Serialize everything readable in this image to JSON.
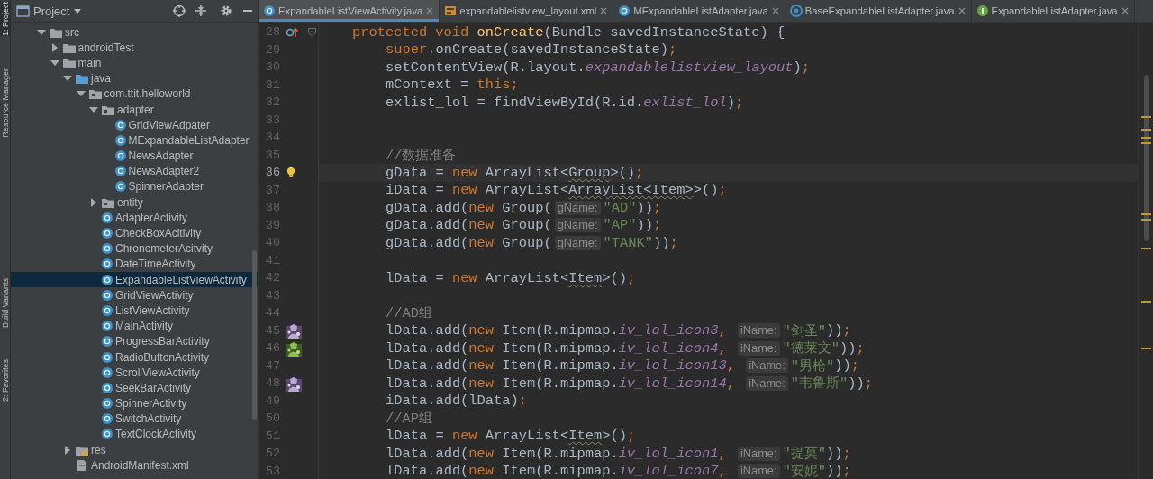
{
  "side_tabs": [
    {
      "label": "1: Project",
      "selected": true
    },
    {
      "label": "Resource Manager",
      "selected": false
    },
    {
      "label": "Build Variants",
      "selected": false
    },
    {
      "label": "2: Favorites",
      "selected": false
    }
  ],
  "project_panel": {
    "title": "Project",
    "tree": [
      {
        "label": "src",
        "kind": "folder",
        "expanded": true,
        "selected": false,
        "children": [
          {
            "label": "androidTest",
            "kind": "folder",
            "expanded": false,
            "selected": false
          },
          {
            "label": "main",
            "kind": "folder",
            "expanded": true,
            "selected": false,
            "children": [
              {
                "label": "java",
                "kind": "source-folder",
                "expanded": true,
                "selected": false,
                "children": [
                  {
                    "label": "com.ttit.helloworld",
                    "kind": "package",
                    "expanded": true,
                    "selected": false,
                    "children": [
                      {
                        "label": "adapter",
                        "kind": "package",
                        "expanded": true,
                        "selected": false,
                        "children": [
                          {
                            "label": "GridViewAdpater",
                            "kind": "class",
                            "selected": false
                          },
                          {
                            "label": "MExpandableListAdapter",
                            "kind": "class",
                            "selected": false
                          },
                          {
                            "label": "NewsAdapter",
                            "kind": "class",
                            "selected": false
                          },
                          {
                            "label": "NewsAdapter2",
                            "kind": "class",
                            "selected": false
                          },
                          {
                            "label": "SpinnerAdapter",
                            "kind": "class",
                            "selected": false
                          }
                        ]
                      },
                      {
                        "label": "entity",
                        "kind": "package",
                        "expanded": false,
                        "selected": false
                      },
                      {
                        "label": "AdapterActivity",
                        "kind": "class",
                        "selected": false
                      },
                      {
                        "label": "CheckBoxAcitivity",
                        "kind": "class",
                        "selected": false
                      },
                      {
                        "label": "ChronometerAcitvity",
                        "kind": "class",
                        "selected": false
                      },
                      {
                        "label": "DateTimeActivity",
                        "kind": "class",
                        "selected": false
                      },
                      {
                        "label": "ExpandableListViewActivity",
                        "kind": "class",
                        "selected": true
                      },
                      {
                        "label": "GridViewActivity",
                        "kind": "class",
                        "selected": false
                      },
                      {
                        "label": "ListViewActivity",
                        "kind": "class",
                        "selected": false
                      },
                      {
                        "label": "MainActivity",
                        "kind": "class",
                        "selected": false
                      },
                      {
                        "label": "ProgressBarActivity",
                        "kind": "class",
                        "selected": false
                      },
                      {
                        "label": "RadioButtonActivity",
                        "kind": "class",
                        "selected": false
                      },
                      {
                        "label": "ScrollViewActivity",
                        "kind": "class",
                        "selected": false
                      },
                      {
                        "label": "SeekBarActivity",
                        "kind": "class",
                        "selected": false
                      },
                      {
                        "label": "SpinnerActivity",
                        "kind": "class",
                        "selected": false
                      },
                      {
                        "label": "SwitchActivity",
                        "kind": "class",
                        "selected": false
                      },
                      {
                        "label": "TextClockActivity",
                        "kind": "class",
                        "selected": false
                      }
                    ]
                  }
                ]
              },
              {
                "label": "res",
                "kind": "res-folder",
                "expanded": false,
                "selected": false
              },
              {
                "label": "AndroidManifest.xml",
                "kind": "manifest",
                "selected": false
              }
            ]
          }
        ]
      }
    ]
  },
  "tabs": [
    {
      "label": "ExpandableListViewActivity.java",
      "kind": "class",
      "selected": true
    },
    {
      "label": "expandablelistview_layout.xml",
      "kind": "xml",
      "selected": false
    },
    {
      "label": "MExpandableListAdapter.java",
      "kind": "class",
      "selected": false
    },
    {
      "label": "BaseExpandableListAdapter.java",
      "kind": "abstract",
      "selected": false
    },
    {
      "label": "ExpandableListAdapter.java",
      "kind": "interface",
      "selected": false
    }
  ],
  "code_lines": [
    {
      "number": "28",
      "kind": "declaration",
      "current": false,
      "markers": [
        {
          "kind": "override"
        },
        {
          "kind": "fold"
        }
      ],
      "tokens": [
        {
          "text": "protected void ",
          "kind": "keyword"
        },
        {
          "text": "onCreate",
          "kind": "method"
        },
        {
          "text": "(Bundle savedInstanceState) {",
          "kind": "plain"
        }
      ]
    },
    {
      "number": "29",
      "kind": "statement",
      "current": false,
      "tokens": [
        {
          "text": "super",
          "kind": "keyword"
        },
        {
          "text": ".onCreate(savedInstanceState)",
          "kind": "plain"
        },
        {
          "text": ";",
          "kind": "keyword"
        }
      ]
    },
    {
      "number": "30",
      "kind": "statement",
      "current": false,
      "tokens": [
        {
          "text": "setContentView(R.layout.",
          "kind": "plain"
        },
        {
          "text": "expandablelistview_layout",
          "kind": "field"
        },
        {
          "text": ")",
          "kind": "plain"
        },
        {
          "text": ";",
          "kind": "keyword"
        }
      ]
    },
    {
      "number": "31",
      "kind": "statement",
      "current": false,
      "tokens": [
        {
          "text": "mContext = ",
          "kind": "plain"
        },
        {
          "text": "this;",
          "kind": "keyword"
        }
      ]
    },
    {
      "number": "32",
      "kind": "statement",
      "current": false,
      "tokens": [
        {
          "text": "exlist_lol = findViewById(R.id.",
          "kind": "plain"
        },
        {
          "text": "exlist_lol",
          "kind": "field"
        },
        {
          "text": ")",
          "kind": "plain"
        },
        {
          "text": ";",
          "kind": "keyword"
        }
      ]
    },
    {
      "number": "33",
      "kind": "blank",
      "current": false
    },
    {
      "number": "34",
      "kind": "blank",
      "current": false
    },
    {
      "number": "35",
      "kind": "statement",
      "current": false,
      "tokens": [
        {
          "text": "//数据准备",
          "kind": "comment"
        }
      ]
    },
    {
      "number": "36",
      "kind": "statement",
      "current": true,
      "markers": [
        {
          "kind": "bulb"
        }
      ],
      "tokens": [
        {
          "text": "gData = ",
          "kind": "plain"
        },
        {
          "text": "new ",
          "kind": "keyword"
        },
        {
          "text": "ArrayList<",
          "kind": "plain"
        },
        {
          "text": "Group",
          "kind": "warning"
        },
        {
          "text": ">()",
          "kind": "plain"
        },
        {
          "text": ";",
          "kind": "keyword"
        }
      ]
    },
    {
      "number": "37",
      "kind": "statement",
      "current": false,
      "tokens": [
        {
          "text": "iData = ",
          "kind": "plain"
        },
        {
          "text": "new ",
          "kind": "keyword"
        },
        {
          "text": "ArrayList<",
          "kind": "plain"
        },
        {
          "text": "ArrayList<Item>",
          "kind": "warning"
        },
        {
          "text": ">()",
          "kind": "plain"
        },
        {
          "text": ";",
          "kind": "keyword"
        }
      ]
    },
    {
      "number": "38",
      "kind": "statement",
      "current": false,
      "tokens": [
        {
          "text": "gData.add(",
          "kind": "plain"
        },
        {
          "text": "new ",
          "kind": "keyword"
        },
        {
          "text": "Group(",
          "kind": "plain"
        },
        {
          "text": "gName:",
          "kind": "hint"
        },
        {
          "text": "\"AD\"",
          "kind": "string"
        },
        {
          "text": "))",
          "kind": "plain"
        },
        {
          "text": ";",
          "kind": "keyword"
        }
      ]
    },
    {
      "number": "39",
      "kind": "statement",
      "current": false,
      "tokens": [
        {
          "text": "gData.add(",
          "kind": "plain"
        },
        {
          "text": "new ",
          "kind": "keyword"
        },
        {
          "text": "Group(",
          "kind": "plain"
        },
        {
          "text": "gName:",
          "kind": "hint"
        },
        {
          "text": "\"AP\"",
          "kind": "string"
        },
        {
          "text": "))",
          "kind": "plain"
        },
        {
          "text": ";",
          "kind": "keyword"
        }
      ]
    },
    {
      "number": "40",
      "kind": "statement",
      "current": false,
      "tokens": [
        {
          "text": "gData.add(",
          "kind": "plain"
        },
        {
          "text": "new ",
          "kind": "keyword"
        },
        {
          "text": "Group(",
          "kind": "plain"
        },
        {
          "text": "gName:",
          "kind": "hint"
        },
        {
          "text": "\"TANK\"",
          "kind": "string"
        },
        {
          "text": "))",
          "kind": "plain"
        },
        {
          "text": ";",
          "kind": "keyword"
        }
      ]
    },
    {
      "number": "41",
      "kind": "blank",
      "current": false
    },
    {
      "number": "42",
      "kind": "statement",
      "current": false,
      "tokens": [
        {
          "text": "lData = ",
          "kind": "plain"
        },
        {
          "text": "new ",
          "kind": "keyword"
        },
        {
          "text": "ArrayList<",
          "kind": "plain"
        },
        {
          "text": "Item",
          "kind": "warning"
        },
        {
          "text": ">()",
          "kind": "plain"
        },
        {
          "text": ";",
          "kind": "keyword"
        }
      ]
    },
    {
      "number": "43",
      "kind": "blank",
      "current": false
    },
    {
      "number": "44",
      "kind": "statement",
      "current": false,
      "tokens": [
        {
          "text": "//AD组",
          "kind": "comment"
        }
      ]
    },
    {
      "number": "45",
      "kind": "statement",
      "current": false,
      "tokens": [
        {
          "text": "lData.add(",
          "kind": "plain"
        },
        {
          "text": "new ",
          "kind": "keyword"
        },
        {
          "text": "Item(R.mipmap.",
          "kind": "plain"
        },
        {
          "text": "iv_lol_icon3",
          "kind": "field"
        },
        {
          "text": ", ",
          "kind": "keyword"
        },
        {
          "text": "iName:",
          "kind": "hint"
        },
        {
          "text": "\"剑圣\"",
          "kind": "string"
        },
        {
          "text": "))",
          "kind": "plain"
        },
        {
          "text": ";",
          "kind": "keyword"
        }
      ]
    },
    {
      "number": "46",
      "kind": "statement",
      "current": false,
      "tokens": [
        {
          "text": "lData.add(",
          "kind": "plain"
        },
        {
          "text": "new ",
          "kind": "keyword"
        },
        {
          "text": "Item(R.mipmap.",
          "kind": "plain"
        },
        {
          "text": "iv_lol_icon4",
          "kind": "field"
        },
        {
          "text": ", ",
          "kind": "keyword"
        },
        {
          "text": "iName:",
          "kind": "hint"
        },
        {
          "text": "\"德莱文\"",
          "kind": "string"
        },
        {
          "text": "))",
          "kind": "plain"
        },
        {
          "text": ";",
          "kind": "keyword"
        }
      ]
    },
    {
      "number": "47",
      "kind": "statement",
      "current": false,
      "tokens": [
        {
          "text": "lData.add(",
          "kind": "plain"
        },
        {
          "text": "new ",
          "kind": "keyword"
        },
        {
          "text": "Item(R.mipmap.",
          "kind": "plain"
        },
        {
          "text": "iv_lol_icon13",
          "kind": "field"
        },
        {
          "text": ", ",
          "kind": "keyword"
        },
        {
          "text": "iName:",
          "kind": "hint"
        },
        {
          "text": "\"男枪\"",
          "kind": "string"
        },
        {
          "text": "))",
          "kind": "plain"
        },
        {
          "text": ";",
          "kind": "keyword"
        }
      ]
    },
    {
      "number": "48",
      "kind": "statement",
      "current": false,
      "tokens": [
        {
          "text": "lData.add(",
          "kind": "plain"
        },
        {
          "text": "new ",
          "kind": "keyword"
        },
        {
          "text": "Item(R.mipmap.",
          "kind": "plain"
        },
        {
          "text": "iv_lol_icon14",
          "kind": "field"
        },
        {
          "text": ", ",
          "kind": "keyword"
        },
        {
          "text": "iName:",
          "kind": "hint"
        },
        {
          "text": "\"韦鲁斯\"",
          "kind": "string"
        },
        {
          "text": "))",
          "kind": "plain"
        },
        {
          "text": ";",
          "kind": "keyword"
        }
      ]
    },
    {
      "number": "49",
      "kind": "statement",
      "current": false,
      "tokens": [
        {
          "text": "iData.add(lData)",
          "kind": "plain"
        },
        {
          "text": ";",
          "kind": "keyword"
        }
      ]
    },
    {
      "number": "50",
      "kind": "statement",
      "current": false,
      "tokens": [
        {
          "text": "//AP组",
          "kind": "comment"
        }
      ]
    },
    {
      "number": "51",
      "kind": "statement",
      "current": false,
      "tokens": [
        {
          "text": "lData = ",
          "kind": "plain"
        },
        {
          "text": "new ",
          "kind": "keyword"
        },
        {
          "text": "ArrayList<",
          "kind": "plain"
        },
        {
          "text": "Item",
          "kind": "warning"
        },
        {
          "text": ">()",
          "kind": "plain"
        },
        {
          "text": ";",
          "kind": "keyword"
        }
      ]
    },
    {
      "number": "52",
      "kind": "statement",
      "current": false,
      "tokens": [
        {
          "text": "lData.add(",
          "kind": "plain"
        },
        {
          "text": "new ",
          "kind": "keyword"
        },
        {
          "text": "Item(R.mipmap.",
          "kind": "plain"
        },
        {
          "text": "iv_lol_icon1",
          "kind": "field"
        },
        {
          "text": ", ",
          "kind": "keyword"
        },
        {
          "text": "iName:",
          "kind": "hint"
        },
        {
          "text": "\"提莫\"",
          "kind": "string"
        },
        {
          "text": "))",
          "kind": "plain"
        },
        {
          "text": ";",
          "kind": "keyword"
        }
      ]
    },
    {
      "number": "53",
      "kind": "statement",
      "current": false,
      "tokens": [
        {
          "text": "lData.add(",
          "kind": "plain"
        },
        {
          "text": "new ",
          "kind": "keyword"
        },
        {
          "text": "Item(R.mipmap.",
          "kind": "plain"
        },
        {
          "text": "iv_lol_icon7",
          "kind": "field"
        },
        {
          "text": ", ",
          "kind": "keyword"
        },
        {
          "text": "iName:",
          "kind": "hint"
        },
        {
          "text": "\"安妮\"",
          "kind": "string"
        },
        {
          "text": "))",
          "kind": "plain"
        },
        {
          "text": ";",
          "kind": "keyword"
        }
      ]
    }
  ]
}
